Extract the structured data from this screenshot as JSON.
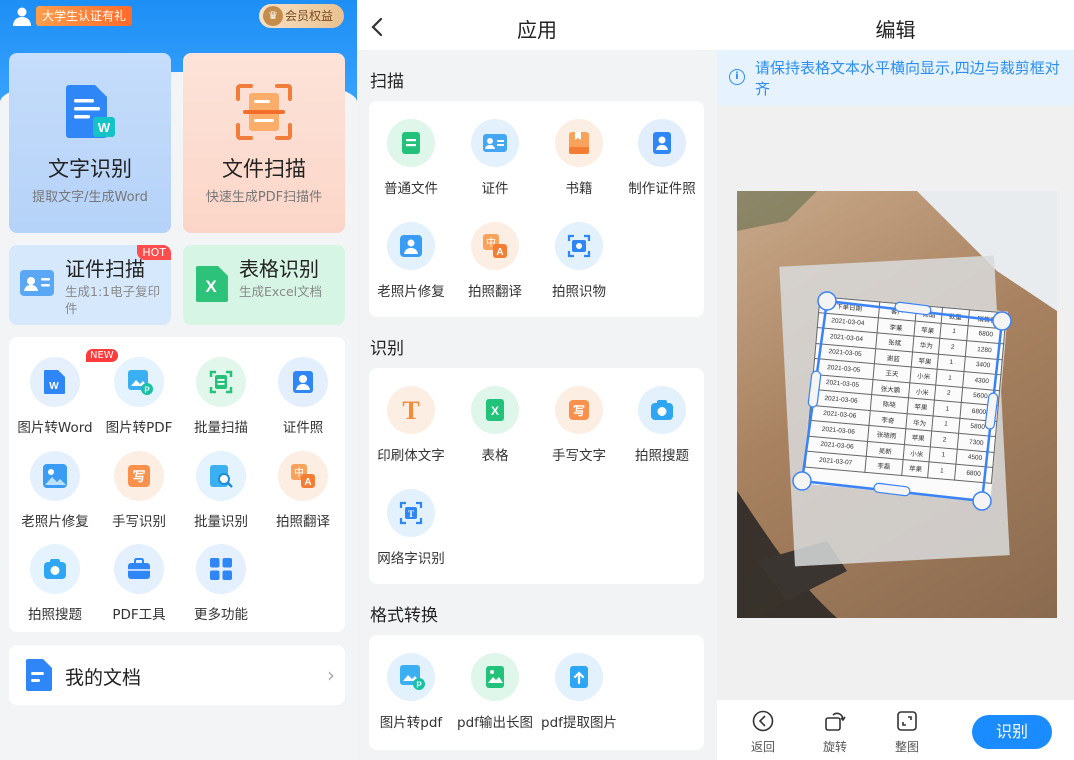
{
  "home": {
    "promo": "大学生认证有礼",
    "vip": "会员权益",
    "big_cards": [
      {
        "title": "文字识别",
        "sub": "提取文字/生成Word"
      },
      {
        "title": "文件扫描",
        "sub": "快速生成PDF扫描件"
      }
    ],
    "mid_cards": [
      {
        "title": "证件扫描",
        "sub": "生成1:1电子复印件",
        "badge": "HOT"
      },
      {
        "title": "表格识别",
        "sub": "生成Excel文档"
      }
    ],
    "new_badge": "NEW",
    "tools": [
      "图片转Word",
      "图片转PDF",
      "批量扫描",
      "证件照",
      "老照片修复",
      "手写识别",
      "批量识别",
      "拍照翻译",
      "拍照搜题",
      "PDF工具",
      "更多功能"
    ],
    "my_docs": "我的文档"
  },
  "apps": {
    "title": "应用",
    "sections": [
      {
        "title": "扫描",
        "items": [
          "普通文件",
          "证件",
          "书籍",
          "制作证件照",
          "老照片修复",
          "拍照翻译",
          "拍照识物"
        ]
      },
      {
        "title": "识别",
        "items": [
          "印刷体文字",
          "表格",
          "手写文字",
          "拍照搜题",
          "网络字识别"
        ]
      },
      {
        "title": "格式转换",
        "items": [
          "图片转pdf",
          "pdf输出长图",
          "pdf提取图片"
        ]
      }
    ]
  },
  "editor": {
    "title": "编辑",
    "tip": "请保持表格文本水平横向显示,四边与裁剪框对齐",
    "table": {
      "headers": [
        "下单日期",
        "客户",
        "商品",
        "数量",
        "销售额"
      ],
      "rows": [
        [
          "2021-03-04",
          "李蒹",
          "苹果",
          "1",
          "6800"
        ],
        [
          "2021-03-04",
          "张斌",
          "华为",
          "2",
          "1280"
        ],
        [
          "2021-03-05",
          "谢蓝",
          "苹果",
          "1",
          "3400"
        ],
        [
          "2021-03-05",
          "王天",
          "小米",
          "1",
          "4300"
        ],
        [
          "2021-03-05",
          "张大鹏",
          "小米",
          "2",
          "5600"
        ],
        [
          "2021-03-06",
          "陈晓",
          "苹果",
          "1",
          "6800"
        ],
        [
          "2021-03-06",
          "李奇",
          "华为",
          "1",
          "5800"
        ],
        [
          "2021-03-06",
          "张晓雨",
          "苹果",
          "2",
          "7300"
        ],
        [
          "2021-03-06",
          "吴新",
          "小米",
          "1",
          "4500"
        ],
        [
          "2021-03-07",
          "李磊",
          "苹果",
          "1",
          "6800"
        ]
      ]
    },
    "actions": [
      "返回",
      "旋转",
      "整图"
    ],
    "confirm": "识别"
  }
}
